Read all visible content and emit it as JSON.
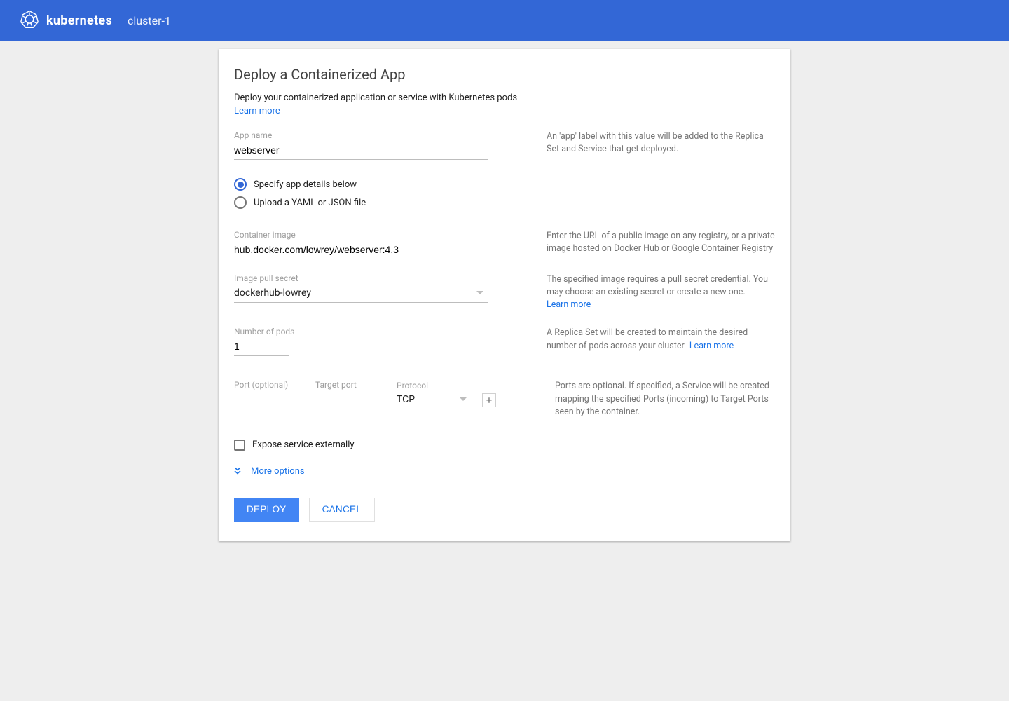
{
  "header": {
    "brand": "kubernetes",
    "cluster": "cluster-1"
  },
  "page": {
    "title": "Deploy a Containerized App",
    "description": "Deploy your containerized application or service with Kubernetes pods",
    "learn_more": "Learn more"
  },
  "form": {
    "app_name": {
      "label": "App name",
      "value": "webserver",
      "help": "An 'app' label with this value will be added to the Replica Set and Service that get deployed."
    },
    "input_mode": {
      "option_details": "Specify app details below",
      "option_upload": "Upload a YAML or JSON file",
      "selected": "details"
    },
    "container_image": {
      "label": "Container image",
      "value": "hub.docker.com/lowrey/webserver:4.3",
      "help": "Enter the URL of a public image on any registry, or a private image hosted on Docker Hub or Google Container Registry"
    },
    "pull_secret": {
      "label": "Image pull secret",
      "value": "dockerhub-lowrey",
      "help": "The specified image requires a pull secret credential. You may choose an existing secret or create a new one.",
      "learn_more": "Learn more"
    },
    "pods": {
      "label": "Number of pods",
      "value": "1",
      "help_prefix": "A Replica Set will be created to maintain the desired number of pods across your cluster",
      "learn_more": "Learn more"
    },
    "ports": {
      "port_label": "Port (optional)",
      "target_label": "Target port",
      "protocol_label": "Protocol",
      "protocol_value": "TCP",
      "add_label": "+",
      "help": "Ports are optional.  If specified, a Service will be created mapping the specified Ports (incoming) to Target Ports seen by the container."
    },
    "expose": {
      "label": "Expose service externally",
      "checked": false
    },
    "more_options": "More options"
  },
  "actions": {
    "deploy": "DEPLOY",
    "cancel": "CANCEL"
  }
}
